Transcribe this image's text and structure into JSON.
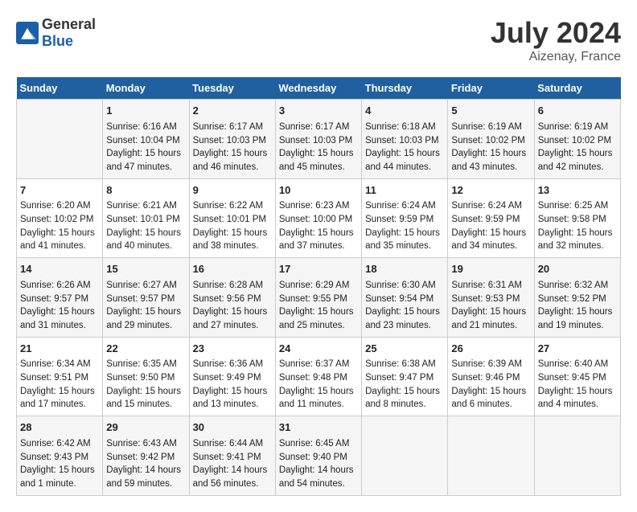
{
  "header": {
    "logo_general": "General",
    "logo_blue": "Blue",
    "title": "July 2024",
    "subtitle": "Aizenay, France"
  },
  "days_of_week": [
    "Sunday",
    "Monday",
    "Tuesday",
    "Wednesday",
    "Thursday",
    "Friday",
    "Saturday"
  ],
  "weeks": [
    [
      {
        "day": "",
        "content": ""
      },
      {
        "day": "1",
        "content": "Sunrise: 6:16 AM\nSunset: 10:04 PM\nDaylight: 15 hours\nand 47 minutes."
      },
      {
        "day": "2",
        "content": "Sunrise: 6:17 AM\nSunset: 10:03 PM\nDaylight: 15 hours\nand 46 minutes."
      },
      {
        "day": "3",
        "content": "Sunrise: 6:17 AM\nSunset: 10:03 PM\nDaylight: 15 hours\nand 45 minutes."
      },
      {
        "day": "4",
        "content": "Sunrise: 6:18 AM\nSunset: 10:03 PM\nDaylight: 15 hours\nand 44 minutes."
      },
      {
        "day": "5",
        "content": "Sunrise: 6:19 AM\nSunset: 10:02 PM\nDaylight: 15 hours\nand 43 minutes."
      },
      {
        "day": "6",
        "content": "Sunrise: 6:19 AM\nSunset: 10:02 PM\nDaylight: 15 hours\nand 42 minutes."
      }
    ],
    [
      {
        "day": "7",
        "content": "Sunrise: 6:20 AM\nSunset: 10:02 PM\nDaylight: 15 hours\nand 41 minutes."
      },
      {
        "day": "8",
        "content": "Sunrise: 6:21 AM\nSunset: 10:01 PM\nDaylight: 15 hours\nand 40 minutes."
      },
      {
        "day": "9",
        "content": "Sunrise: 6:22 AM\nSunset: 10:01 PM\nDaylight: 15 hours\nand 38 minutes."
      },
      {
        "day": "10",
        "content": "Sunrise: 6:23 AM\nSunset: 10:00 PM\nDaylight: 15 hours\nand 37 minutes."
      },
      {
        "day": "11",
        "content": "Sunrise: 6:24 AM\nSunset: 9:59 PM\nDaylight: 15 hours\nand 35 minutes."
      },
      {
        "day": "12",
        "content": "Sunrise: 6:24 AM\nSunset: 9:59 PM\nDaylight: 15 hours\nand 34 minutes."
      },
      {
        "day": "13",
        "content": "Sunrise: 6:25 AM\nSunset: 9:58 PM\nDaylight: 15 hours\nand 32 minutes."
      }
    ],
    [
      {
        "day": "14",
        "content": "Sunrise: 6:26 AM\nSunset: 9:57 PM\nDaylight: 15 hours\nand 31 minutes."
      },
      {
        "day": "15",
        "content": "Sunrise: 6:27 AM\nSunset: 9:57 PM\nDaylight: 15 hours\nand 29 minutes."
      },
      {
        "day": "16",
        "content": "Sunrise: 6:28 AM\nSunset: 9:56 PM\nDaylight: 15 hours\nand 27 minutes."
      },
      {
        "day": "17",
        "content": "Sunrise: 6:29 AM\nSunset: 9:55 PM\nDaylight: 15 hours\nand 25 minutes."
      },
      {
        "day": "18",
        "content": "Sunrise: 6:30 AM\nSunset: 9:54 PM\nDaylight: 15 hours\nand 23 minutes."
      },
      {
        "day": "19",
        "content": "Sunrise: 6:31 AM\nSunset: 9:53 PM\nDaylight: 15 hours\nand 21 minutes."
      },
      {
        "day": "20",
        "content": "Sunrise: 6:32 AM\nSunset: 9:52 PM\nDaylight: 15 hours\nand 19 minutes."
      }
    ],
    [
      {
        "day": "21",
        "content": "Sunrise: 6:34 AM\nSunset: 9:51 PM\nDaylight: 15 hours\nand 17 minutes."
      },
      {
        "day": "22",
        "content": "Sunrise: 6:35 AM\nSunset: 9:50 PM\nDaylight: 15 hours\nand 15 minutes."
      },
      {
        "day": "23",
        "content": "Sunrise: 6:36 AM\nSunset: 9:49 PM\nDaylight: 15 hours\nand 13 minutes."
      },
      {
        "day": "24",
        "content": "Sunrise: 6:37 AM\nSunset: 9:48 PM\nDaylight: 15 hours\nand 11 minutes."
      },
      {
        "day": "25",
        "content": "Sunrise: 6:38 AM\nSunset: 9:47 PM\nDaylight: 15 hours\nand 8 minutes."
      },
      {
        "day": "26",
        "content": "Sunrise: 6:39 AM\nSunset: 9:46 PM\nDaylight: 15 hours\nand 6 minutes."
      },
      {
        "day": "27",
        "content": "Sunrise: 6:40 AM\nSunset: 9:45 PM\nDaylight: 15 hours\nand 4 minutes."
      }
    ],
    [
      {
        "day": "28",
        "content": "Sunrise: 6:42 AM\nSunset: 9:43 PM\nDaylight: 15 hours\nand 1 minute."
      },
      {
        "day": "29",
        "content": "Sunrise: 6:43 AM\nSunset: 9:42 PM\nDaylight: 14 hours\nand 59 minutes."
      },
      {
        "day": "30",
        "content": "Sunrise: 6:44 AM\nSunset: 9:41 PM\nDaylight: 14 hours\nand 56 minutes."
      },
      {
        "day": "31",
        "content": "Sunrise: 6:45 AM\nSunset: 9:40 PM\nDaylight: 14 hours\nand 54 minutes."
      },
      {
        "day": "",
        "content": ""
      },
      {
        "day": "",
        "content": ""
      },
      {
        "day": "",
        "content": ""
      }
    ]
  ]
}
